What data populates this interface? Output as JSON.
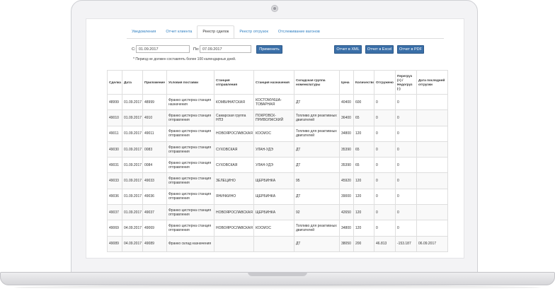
{
  "tabs": [
    "Уведомления",
    "Отчет клиента",
    "Реестр сделок",
    "Реестр отгрузок",
    "Отслеживание вагонов"
  ],
  "active_tab": "Реестр сделок",
  "filters": {
    "from_label": "С:",
    "from_value": "01.09.2017",
    "to_label": "По:",
    "to_value": "07.09.2017",
    "apply_label": "Применить",
    "note": "* Период не должен составлять более 100 календарных дней."
  },
  "export": {
    "xml": "Отчет в XML",
    "excel": "Отчет в Excel",
    "pdf": "Отчет в PDF"
  },
  "table": {
    "headers": [
      "Сделка",
      "Дата",
      "Приложение",
      "Условия поставки",
      "Станция отправления",
      "Станция назначения",
      "Складская группа номенклатуры",
      "Цена",
      "Количество",
      "Отгружено",
      "Перегруз (+) / Недогруз (-)",
      "Дата последней отгрузки"
    ],
    "rows": [
      [
        "48999",
        "01.09.2017",
        "48999",
        "Франко цистерна станция назначения",
        "КОМБИНАТСКАЯ",
        "КОСТОМУКША-ТОВАРНАЯ",
        "ДТ",
        "40400",
        "600",
        "0",
        "0",
        ""
      ],
      [
        "49010",
        "01.09.2017",
        "4910",
        "Франко цистерна станция отправления",
        "Самарская группа НПЗ",
        "ПОКРОВСК-ПРИВОЛЖСКИЙ",
        "Топливо для реактивных двигателей",
        "36400",
        "65",
        "0",
        "0",
        ""
      ],
      [
        "49011",
        "01.09.2017",
        "49011",
        "Франко цистерна станция отправления",
        "НОВОЯРОСЛАВСКАЯ",
        "КОСМОС",
        "Топливо для реактивных двигателей",
        "34800",
        "120",
        "0",
        "0",
        ""
      ],
      [
        "49030",
        "01.09.2017",
        "0083",
        "Франко цистерна станция отправления",
        "СУХОВСКАЯ",
        "УЛАН-УДЭ",
        "ДТ",
        "35390",
        "65",
        "0",
        "0",
        ""
      ],
      [
        "49031",
        "01.09.2017",
        "0084",
        "Франко цистерна станция отправления",
        "СУХОВСКАЯ",
        "УЛАН-УДЭ",
        "ДТ",
        "35390",
        "65",
        "0",
        "0",
        ""
      ],
      [
        "49033",
        "01.09.2017",
        "49033",
        "Франко цистерна станция отправления",
        "ЗЕЛЕЦИНО",
        "ЩЕРБИНКА",
        "95",
        "45920",
        "120",
        "0",
        "0",
        ""
      ],
      [
        "49036",
        "01.09.2017",
        "49036",
        "Франко цистерна станция отправления",
        "ЯНИЧКИНО",
        "ЩЕРБИНКА",
        "ДТ",
        "39000",
        "120",
        "0",
        "0",
        ""
      ],
      [
        "49037",
        "01.09.2017",
        "49037",
        "Франко цистерна станция отправления",
        "НОВОЯРОСЛАВСКАЯ",
        "ЩЕРБИНКА",
        "92",
        "42650",
        "120",
        "0",
        "0",
        ""
      ],
      [
        "49069",
        "04.09.2017",
        "49069",
        "Франко цистерна станция отправления",
        "НОВОЯРОСЛАВСКАЯ",
        "КОСМОС",
        "Топливо для реактивных двигателей",
        "34800",
        "120",
        "0",
        "0",
        ""
      ],
      [
        "49089",
        "04.09.2017",
        "49089",
        "Франко склад назначения",
        "",
        "",
        "ДТ",
        "38050",
        "200",
        "46.813",
        "-153.187",
        "06.09.2017"
      ]
    ]
  }
}
